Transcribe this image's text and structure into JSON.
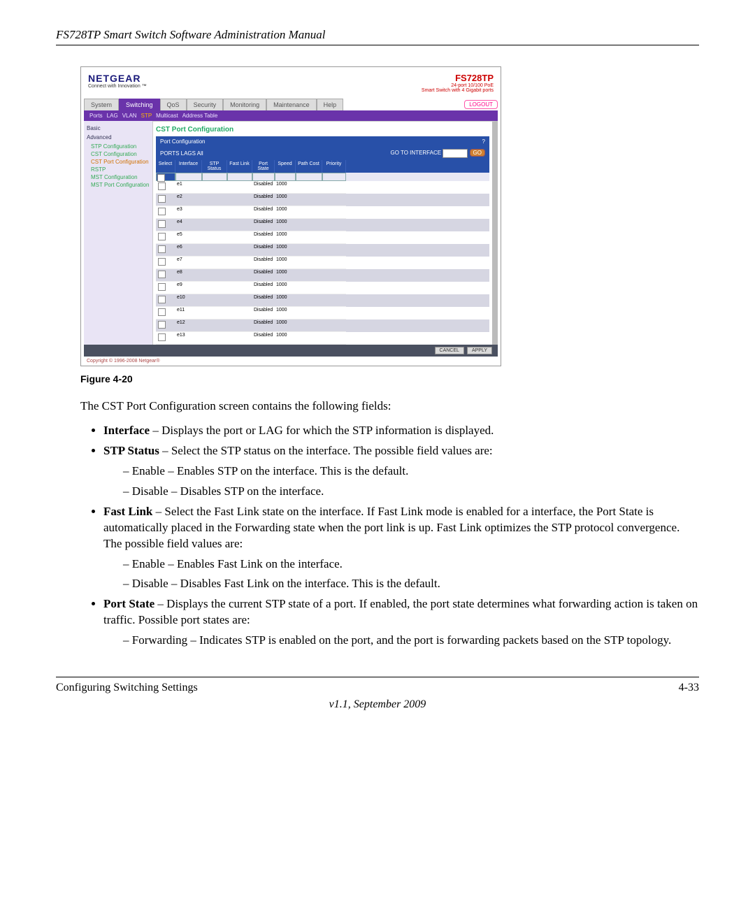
{
  "header": {
    "title": "FS728TP Smart Switch Software Administration Manual"
  },
  "shot": {
    "brand": "NETGEAR",
    "brand_sub": "Connect with Innovation ™",
    "product": "FS728TP",
    "product_sub1": "24-port 10/100 PoE",
    "product_sub2": "Smart Switch with 4 Gigabit ports",
    "tabs": [
      "System",
      "Switching",
      "QoS",
      "Security",
      "Monitoring",
      "Maintenance",
      "Help"
    ],
    "logout": "LOGOUT",
    "subtabs": [
      "Ports",
      "LAG",
      "VLAN",
      "STP",
      "Multicast",
      "Address Table"
    ],
    "sidebar": {
      "groups": [
        "Basic",
        "Advanced"
      ],
      "links": [
        "STP Configuration",
        "CST Configuration",
        "CST Port Configuration",
        "RSTP",
        "MST Configuration",
        "MST Port Configuration"
      ]
    },
    "section": "CST Port Configuration",
    "panel": "Port Configuration",
    "portsbar_left": "PORTS LAGS All",
    "goto_label": "GO TO INTERFACE",
    "go": "GO",
    "columns": [
      "Select",
      "Interface",
      "STP Status",
      "Fast Link",
      "Port State",
      "Speed",
      "Path Cost",
      "Priority"
    ],
    "rows": [
      {
        "iface": "e1",
        "state": "Disabled",
        "speed": "1000"
      },
      {
        "iface": "e2",
        "state": "Disabled",
        "speed": "1000"
      },
      {
        "iface": "e3",
        "state": "Disabled",
        "speed": "1000"
      },
      {
        "iface": "e4",
        "state": "Disabled",
        "speed": "1000"
      },
      {
        "iface": "e5",
        "state": "Disabled",
        "speed": "1000"
      },
      {
        "iface": "e6",
        "state": "Disabled",
        "speed": "1000"
      },
      {
        "iface": "e7",
        "state": "Disabled",
        "speed": "1000"
      },
      {
        "iface": "e8",
        "state": "Disabled",
        "speed": "1000"
      },
      {
        "iface": "e9",
        "state": "Disabled",
        "speed": "1000"
      },
      {
        "iface": "e10",
        "state": "Disabled",
        "speed": "1000"
      },
      {
        "iface": "e11",
        "state": "Disabled",
        "speed": "1000"
      },
      {
        "iface": "e12",
        "state": "Disabled",
        "speed": "1000"
      },
      {
        "iface": "e13",
        "state": "Disabled",
        "speed": "1000"
      }
    ],
    "cancel": "CANCEL",
    "apply": "APPLY",
    "copyright": "Copyright © 1996-2008 Netgear®"
  },
  "figure": "Figure 4-20",
  "intro": "The CST Port Configuration screen contains the following fields:",
  "bullets": {
    "b1_strong": "Interface",
    "b1_text": " – Displays the port or LAG for which the STP information is displayed.",
    "b2_strong": "STP Status",
    "b2_text": " – Select the STP status on the interface. The possible field values are:",
    "b2a": "Enable – Enables STP on the interface. This is the default.",
    "b2b": "Disable – Disables STP on the interface.",
    "b3_strong": "Fast Link",
    "b3_text": " – Select the Fast Link state on the interface. If Fast Link mode is enabled for a interface, the Port State is automatically placed in the Forwarding state when the port link is up. Fast Link optimizes the STP protocol convergence. The possible field values are:",
    "b3a": "Enable – Enables Fast Link on the interface.",
    "b3b": "Disable – Disables Fast Link on the interface. This is the default.",
    "b4_strong": "Port State",
    "b4_text": " – Displays the current STP state of a port. If enabled, the port state determines what forwarding action is taken on traffic. Possible port states are:",
    "b4a": "Forwarding – Indicates STP is enabled on the port, and the port is forwarding packets based on the STP topology."
  },
  "footer": {
    "left": "Configuring Switching Settings",
    "right": "4-33",
    "version": "v1.1, September 2009"
  }
}
